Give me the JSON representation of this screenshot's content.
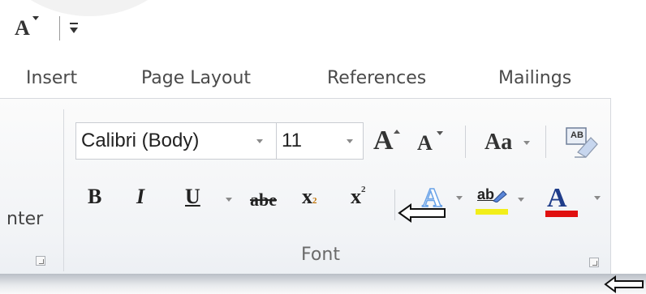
{
  "quick_access": {
    "shrink_glyph": "A",
    "customize_icon": "customize-qat-icon"
  },
  "tabs": [
    {
      "label": "Insert"
    },
    {
      "label": "Page Layout"
    },
    {
      "label": "References"
    },
    {
      "label": "Mailings"
    }
  ],
  "ribbon": {
    "partial_label": "nter",
    "font_group": {
      "font_name": "Calibri (Body)",
      "font_size": "11",
      "grow_glyph": "A",
      "shrink_glyph": "A",
      "change_case_glyph": "Aa",
      "clear_format_glyph": "AB",
      "bold": "B",
      "italic": "I",
      "underline": "U",
      "strike": "abe",
      "subscript": "x",
      "subscript_small": "2",
      "superscript": "x",
      "superscript_small": "2",
      "text_effects_glyph": "A",
      "highlight_glyph": "ab",
      "font_color_glyph": "A",
      "label": "Font"
    }
  },
  "colors": {
    "highlight_yellow": "#f2ee1a",
    "font_color_red": "#e01010",
    "text_effects_blue": "#6aa3e8"
  }
}
